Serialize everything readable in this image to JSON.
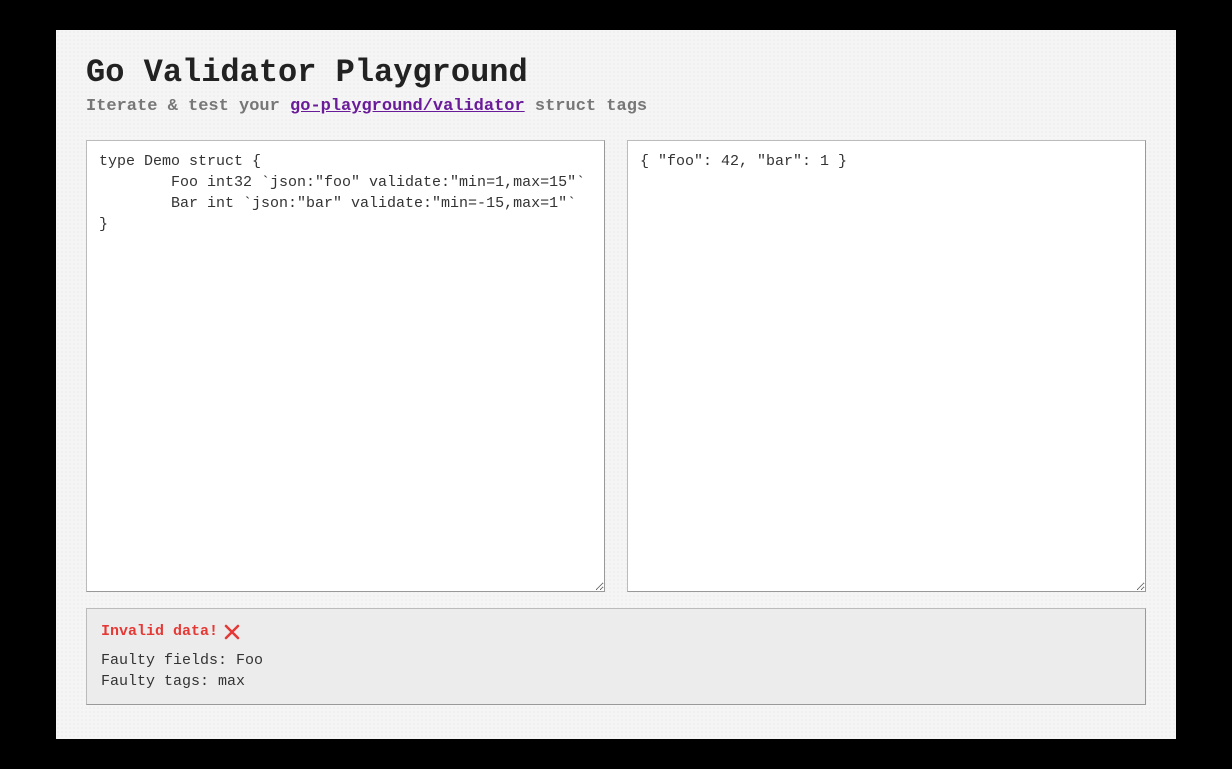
{
  "header": {
    "title": "Go Validator Playground",
    "subtitle_prefix": "Iterate & test your ",
    "subtitle_link": "go-playground/validator",
    "subtitle_suffix": " struct tags"
  },
  "editors": {
    "struct_code": "type Demo struct {\n        Foo int32 `json:\"foo\" validate:\"min=1,max=15\"`\n        Bar int `json:\"bar\" validate:\"min=-15,max=1\"`\n}",
    "json_input": "{ \"foo\": 42, \"bar\": 1 }"
  },
  "result": {
    "status_label": "Invalid data!",
    "faulty_fields_label": "Faulty fields: ",
    "faulty_fields_value": "Foo",
    "faulty_tags_label": "Faulty tags: ",
    "faulty_tags_value": "max"
  }
}
